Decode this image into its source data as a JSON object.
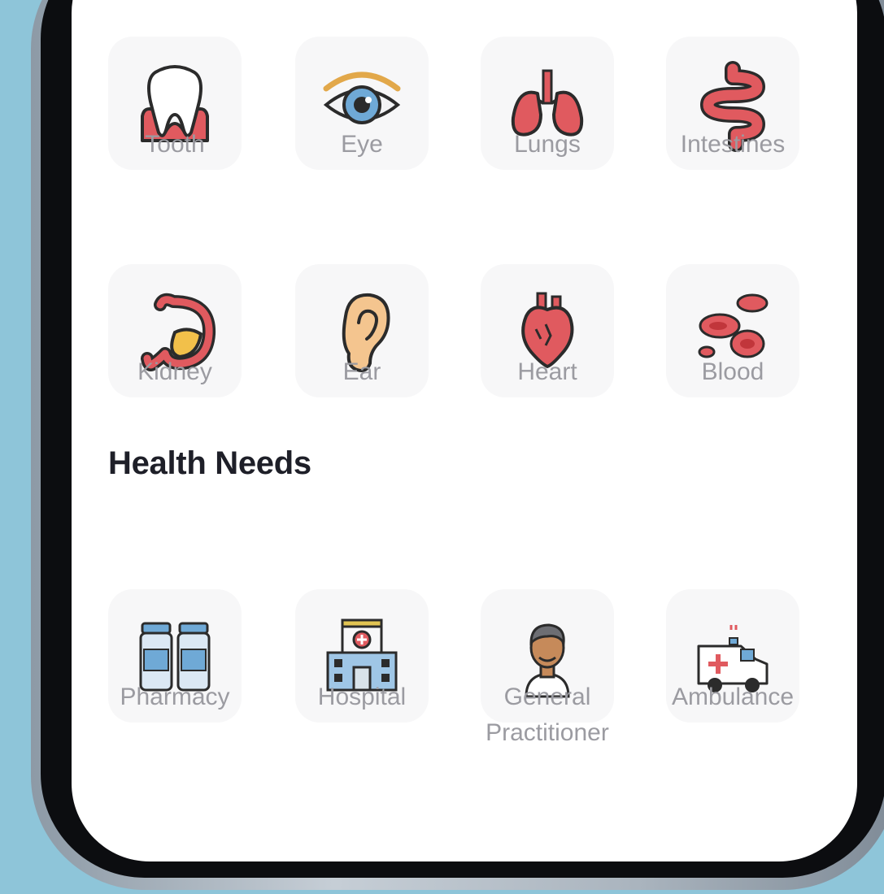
{
  "organs": [
    {
      "label": "Tooth",
      "icon": "tooth-icon"
    },
    {
      "label": "Eye",
      "icon": "eye-icon"
    },
    {
      "label": "Lungs",
      "icon": "lungs-icon"
    },
    {
      "label": "Intestines",
      "icon": "intestines-icon"
    },
    {
      "label": "Kidney",
      "icon": "kidney-icon"
    },
    {
      "label": "Ear",
      "icon": "ear-icon"
    },
    {
      "label": "Heart",
      "icon": "heart-icon"
    },
    {
      "label": "Blood",
      "icon": "blood-icon"
    }
  ],
  "health_needs": {
    "title": "Health Needs",
    "items": [
      {
        "label": "Pharmacy",
        "icon": "pharmacy-icon"
      },
      {
        "label": "Hospital",
        "icon": "hospital-icon"
      },
      {
        "label": "General Practitioner",
        "label_line1": "General",
        "label_line2": "Practitioner",
        "icon": "doctor-icon"
      },
      {
        "label": "Ambulance",
        "icon": "ambulance-icon"
      }
    ]
  },
  "colors": {
    "background": "#8ec5d9",
    "accent_red": "#e05a5f",
    "tile": "#f7f7f8",
    "label_gray": "#9b9ba1",
    "title_dark": "#1e1f28"
  }
}
